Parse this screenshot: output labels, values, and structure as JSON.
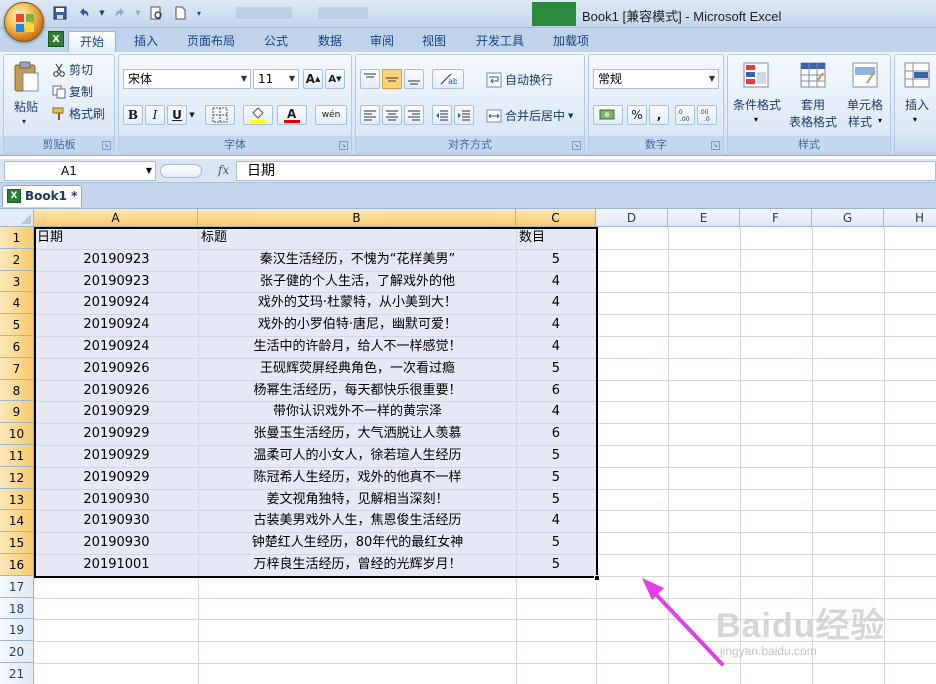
{
  "window": {
    "title": "Book1  [兼容模式] - Microsoft Excel"
  },
  "ribbon_tabs": [
    "开始",
    "插入",
    "页面布局",
    "公式",
    "数据",
    "审阅",
    "视图",
    "开发工具",
    "加载项"
  ],
  "clipboard": {
    "paste": "粘贴",
    "cut": "剪切",
    "copy": "复制",
    "format_painter": "格式刷",
    "group_label": "剪贴板"
  },
  "font": {
    "name": "宋体",
    "size": "11",
    "bold": "B",
    "italic": "I",
    "underline": "U",
    "phonetic": "wén",
    "group_label": "字体"
  },
  "alignment": {
    "wrap_text": "自动换行",
    "merge_center": "合并后居中",
    "group_label": "对齐方式"
  },
  "number": {
    "format": "常规",
    "percent": "%",
    "comma": ",",
    "group_label": "数字"
  },
  "styles": {
    "conditional_formatting": "条件格式",
    "format_table_1": "套用",
    "format_table_2": "表格格式",
    "cell_styles_1": "单元格",
    "cell_styles_2": "样式",
    "group_label": "样式"
  },
  "cells_group": {
    "insert": "插入"
  },
  "formula_bar": {
    "name_box": "A1",
    "fx": "fx",
    "formula": "日期"
  },
  "workbook_tab": "Book1 *",
  "columns": [
    "A",
    "B",
    "C",
    "D",
    "E",
    "F",
    "G",
    "H"
  ],
  "row_numbers": [
    "1",
    "2",
    "3",
    "4",
    "5",
    "6",
    "7",
    "8",
    "9",
    "10",
    "11",
    "12",
    "13",
    "14",
    "15",
    "16",
    "17",
    "18",
    "19",
    "20",
    "21",
    "22"
  ],
  "sheet": {
    "header": {
      "a": "日期",
      "b": "标题",
      "c": "数目"
    },
    "rows": [
      {
        "a": "20190923",
        "b": "秦汉生活经历，不愧为“花样美男”",
        "c": "5"
      },
      {
        "a": "20190923",
        "b": "张子健的个人生活，了解戏外的他",
        "c": "4"
      },
      {
        "a": "20190924",
        "b": "戏外的艾玛·杜蒙特，从小美到大！",
        "c": "4"
      },
      {
        "a": "20190924",
        "b": "戏外的小罗伯特·唐尼，幽默可爱！",
        "c": "4"
      },
      {
        "a": "20190924",
        "b": "生活中的许龄月，给人不一样感觉！",
        "c": "4"
      },
      {
        "a": "20190926",
        "b": "王砚辉荧屏经典角色，一次看过瘾",
        "c": "5"
      },
      {
        "a": "20190926",
        "b": "杨幂生活经历，每天都快乐很重要！",
        "c": "6"
      },
      {
        "a": "20190929",
        "b": "带你认识戏外不一样的黄宗泽",
        "c": "4"
      },
      {
        "a": "20190929",
        "b": "张曼玉生活经历，大气洒脱让人羡慕",
        "c": "6"
      },
      {
        "a": "20190929",
        "b": "温柔可人的小女人，徐若瑄人生经历",
        "c": "5"
      },
      {
        "a": "20190929",
        "b": "陈冠希人生经历，戏外的他真不一样",
        "c": "5"
      },
      {
        "a": "20190930",
        "b": "姜文视角独特，见解相当深刻！",
        "c": "5"
      },
      {
        "a": "20190930",
        "b": "古装美男戏外人生，焦恩俊生活经历",
        "c": "4"
      },
      {
        "a": "20190930",
        "b": "钟楚红人生经历，80年代的最红女神",
        "c": "5"
      },
      {
        "a": "20191001",
        "b": "万梓良生活经历，曾经的光辉岁月！",
        "c": "5"
      }
    ]
  },
  "watermark": {
    "main": "Baidu经验",
    "sub": "jingyan.baidu.com"
  },
  "colors": {
    "annotation_arrow": "#e040e8",
    "selection_fill": "#e5e9f5",
    "header_selected": "#f7c96b"
  }
}
